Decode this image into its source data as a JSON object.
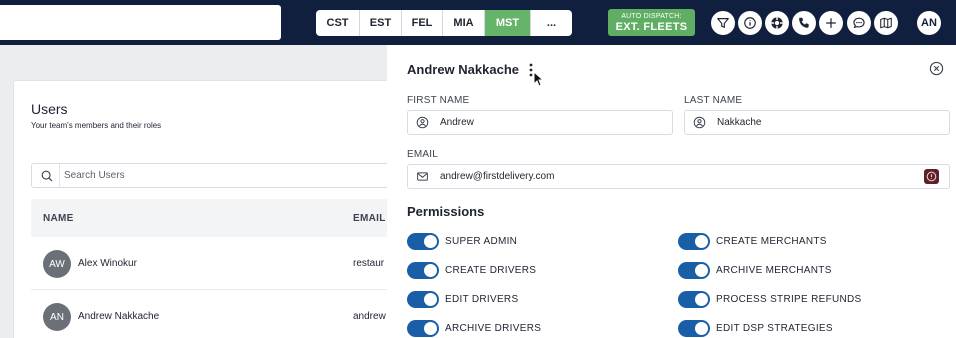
{
  "topbar": {
    "timezones": [
      {
        "label": "CST",
        "active": false
      },
      {
        "label": "EST",
        "active": false
      },
      {
        "label": "FEL",
        "active": false
      },
      {
        "label": "MIA",
        "active": false
      },
      {
        "label": "MST",
        "active": true
      },
      {
        "label": "...",
        "active": false
      }
    ],
    "dispatch": {
      "line1": "AUTO DISPATCH:",
      "line2": "EXT. FLEETS"
    },
    "icons": [
      "filter-icon",
      "info-icon",
      "lifebuoy-icon",
      "phone-icon",
      "plus-icon",
      "chat-icon",
      "map-icon"
    ],
    "user_initials": "AN"
  },
  "users": {
    "title": "Users",
    "subtitle": "Your team's members and their roles",
    "search_placeholder": "Search Users",
    "columns": {
      "name": "NAME",
      "email": "EMAIL"
    },
    "rows": [
      {
        "initials": "AW",
        "name": "Alex Winokur",
        "email": "restaur"
      },
      {
        "initials": "AN",
        "name": "Andrew Nakkache",
        "email": "andrew"
      }
    ]
  },
  "drawer": {
    "title": "Andrew Nakkache",
    "first_name_label": "FIRST NAME",
    "first_name_value": "Andrew",
    "last_name_label": "LAST NAME",
    "last_name_value": "Nakkache",
    "email_label": "EMAIL",
    "email_value": "andrew@firstdelivery.com",
    "permissions_title": "Permissions",
    "permissions": [
      {
        "label": "SUPER ADMIN",
        "enabled": true
      },
      {
        "label": "CREATE MERCHANTS",
        "enabled": true
      },
      {
        "label": "CREATE DRIVERS",
        "enabled": true
      },
      {
        "label": "ARCHIVE MERCHANTS",
        "enabled": true
      },
      {
        "label": "EDIT DRIVERS",
        "enabled": true
      },
      {
        "label": "PROCESS STRIPE REFUNDS",
        "enabled": true
      },
      {
        "label": "ARCHIVE DRIVERS",
        "enabled": true
      },
      {
        "label": "EDIT DSP STRATEGIES",
        "enabled": true
      }
    ]
  },
  "colors": {
    "navbar": "#0f1f3d",
    "active_green": "#66b36a",
    "toggle_blue": "#1a5ea8"
  }
}
